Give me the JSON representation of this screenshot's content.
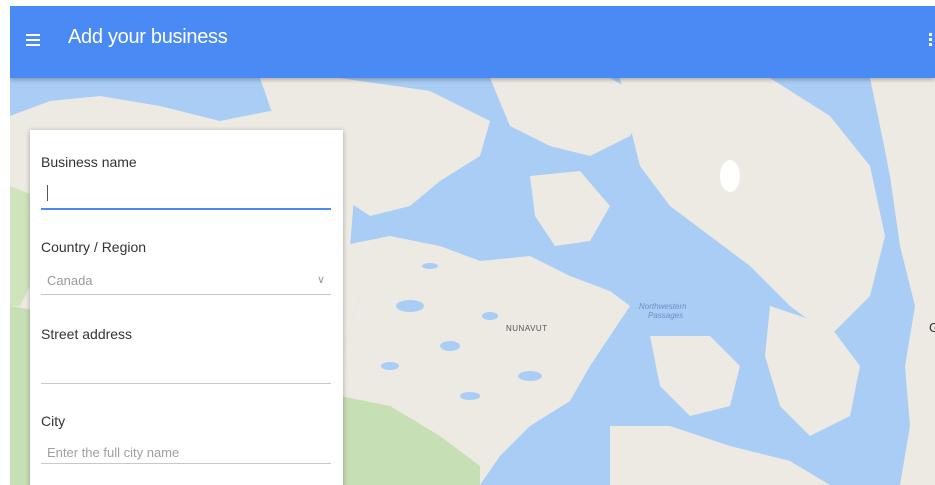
{
  "app_bar": {
    "title": "Add your business",
    "menu_icon": "hamburger-menu-icon",
    "more_icon": "more-vert-icon",
    "color": "#4a8af4"
  },
  "form": {
    "business_name": {
      "label": "Business name",
      "value": "",
      "placeholder": ""
    },
    "country": {
      "label": "Country / Region",
      "value": "Canada",
      "icon": "chevron-down-icon"
    },
    "street_address": {
      "label": "Street address",
      "value": "",
      "placeholder": ""
    },
    "city": {
      "label": "City",
      "value": "",
      "placeholder": "Enter the full city name"
    }
  },
  "map": {
    "labels": {
      "nunavut": "NUNAVUT",
      "northwestern_passages_1": "Northwestern",
      "northwestern_passages_2": "Passages",
      "edge_letter": "G"
    },
    "water_color": "#a9cdf5",
    "land_color": "#eceae2",
    "forest_color": "#c6dfb4"
  }
}
